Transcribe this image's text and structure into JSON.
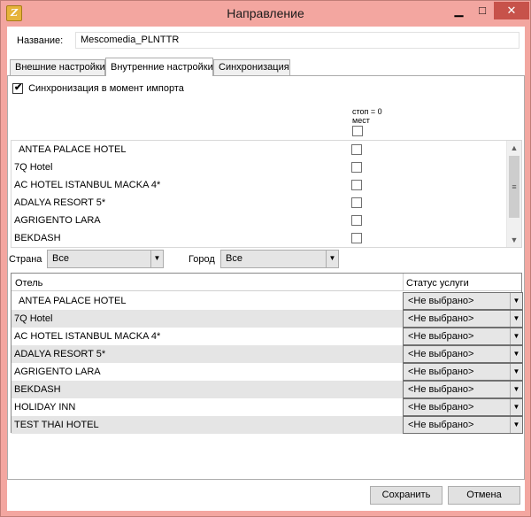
{
  "window": {
    "title": "Направление",
    "minimize_label": "▁",
    "maximize_label": "□",
    "close_label": "✕"
  },
  "form": {
    "name_label": "Название:",
    "name_value": "Mescomedia_PLNTTR"
  },
  "tabs": [
    {
      "label": "Внешние настройки",
      "active": false
    },
    {
      "label": "Внутренние настройки",
      "active": true
    },
    {
      "label": "Синхронизация",
      "active": false
    }
  ],
  "sync": {
    "label": "Синхронизация в момент импорта",
    "checked": true
  },
  "stop_column": {
    "header": "стоп = 0 мест"
  },
  "hotel_list": [
    {
      "name": "ANTEA PALACE HOTEL",
      "checked": false
    },
    {
      "name": "7Q Hotel",
      "checked": false
    },
    {
      "name": "AC HOTEL ISTANBUL MACKA 4*",
      "checked": false
    },
    {
      "name": "ADALYA RESORT 5*",
      "checked": false
    },
    {
      "name": "AGRIGENTO LARA",
      "checked": false
    },
    {
      "name": "BEKDASH",
      "checked": false
    }
  ],
  "filters": {
    "country_label": "Страна",
    "country_value": "Все",
    "city_label": "Город",
    "city_value": "Все"
  },
  "grid": {
    "col_hotel": "Отель",
    "col_status": "Статус услуги",
    "rows": [
      {
        "hotel": "ANTEA PALACE HOTEL",
        "status": "<Не выбрано>"
      },
      {
        "hotel": "7Q Hotel",
        "status": "<Не выбрано>"
      },
      {
        "hotel": "AC HOTEL ISTANBUL MACKA 4*",
        "status": "<Не выбрано>"
      },
      {
        "hotel": "ADALYA RESORT 5*",
        "status": "<Не выбрано>"
      },
      {
        "hotel": "AGRIGENTO LARA",
        "status": "<Не выбрано>"
      },
      {
        "hotel": "BEKDASH",
        "status": "<Не выбрано>"
      },
      {
        "hotel": "HOLIDAY INN",
        "status": "<Не выбрано>"
      },
      {
        "hotel": "TEST THAI HOTEL",
        "status": "<Не выбрано>"
      }
    ]
  },
  "buttons": {
    "save": "Сохранить",
    "cancel": "Отмена"
  },
  "icons": {
    "app": "app-icon",
    "checkmark": "✔",
    "dropdown": "▼",
    "scroll_up": "▲",
    "scroll_down": "▼",
    "scroll_grip": "≡"
  },
  "colors": {
    "title_bar": "#f3a6a0",
    "close_button": "#c7524a",
    "row_alt": "#e5e5e5"
  }
}
